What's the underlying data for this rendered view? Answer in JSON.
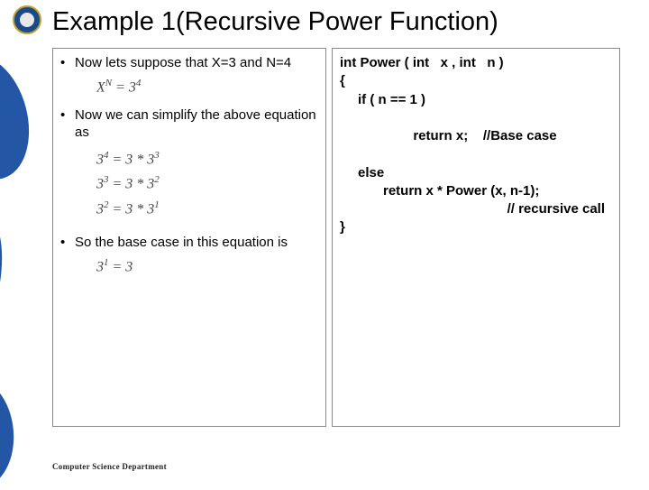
{
  "title": "Example 1(Recursive Power Function)",
  "left": {
    "b1": "Now lets suppose that X=3 and N=4",
    "f1_html": "X<sup>N</sup> = 3<sup>4</sup>",
    "b2": "Now we can simplify the above equation as",
    "f2a_html": "3<sup>4</sup> = 3 * 3<sup>3</sup>",
    "f2b_html": "3<sup>3</sup> = 3 * 3<sup>2</sup>",
    "f2c_html": "3<sup>2</sup> = 3 * 3<sup>1</sup>",
    "b3": "So the base case in this equation is",
    "f3_html": "3<sup>1</sup> = 3"
  },
  "code": {
    "l1": "int Power ( int   x , int   n )",
    "l2": "{",
    "l3": "if ( n == 1 )",
    "l4a": "return x;",
    "l4b": "//Base case",
    "l5": "else",
    "l6": "return x * Power (x, n-1);",
    "l7": "// recursive call",
    "l8": "}"
  },
  "footer": "Computer Science Department"
}
